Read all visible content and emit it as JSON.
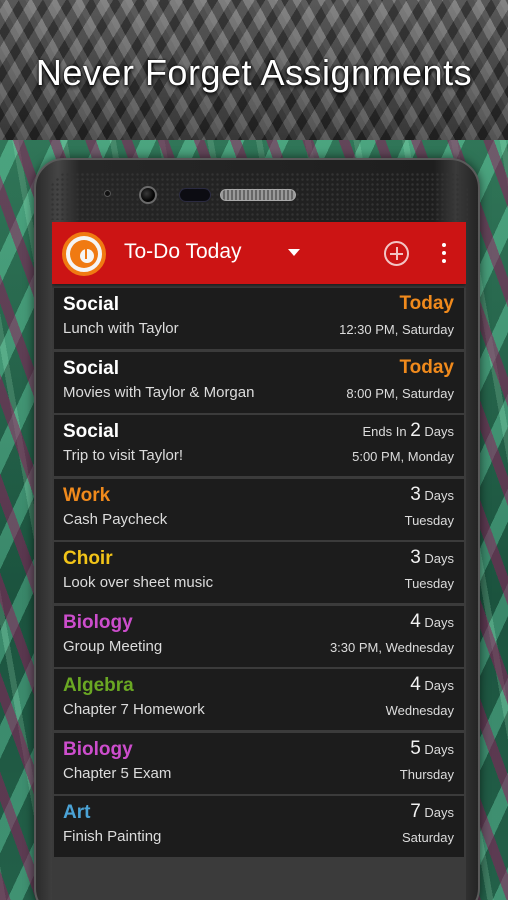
{
  "headline": "Never Forget Assignments",
  "app_bar": {
    "title": "To-Do Today",
    "logo_icon": "clock-logo-icon",
    "dropdown_icon": "triangle-down-icon",
    "add_icon": "plus-circle-icon",
    "more_icon": "more-vert-icon",
    "color": "#cc1414"
  },
  "colors": {
    "social": "#ffffff",
    "work": "#f08a1c",
    "choir": "#f2c418",
    "biology": "#cc4dcc",
    "algebra": "#6aa823",
    "art": "#4ba3d6",
    "today": "#f08a1c"
  },
  "assignments": [
    {
      "category": "Social",
      "color": "#ffffff",
      "description": "Lunch with Taylor",
      "due_prefix": "",
      "due_num": "",
      "due_suffix": "",
      "due_today": "Today",
      "when": "12:30 PM, Saturday"
    },
    {
      "category": "Social",
      "color": "#ffffff",
      "description": "Movies with Taylor & Morgan",
      "due_prefix": "",
      "due_num": "",
      "due_suffix": "",
      "due_today": "Today",
      "when": "8:00 PM, Saturday"
    },
    {
      "category": "Social",
      "color": "#ffffff",
      "description": "Trip to visit Taylor!",
      "due_prefix": "Ends In ",
      "due_num": "2",
      "due_suffix": " Days",
      "due_today": "",
      "when": "5:00 PM, Monday"
    },
    {
      "category": "Work",
      "color": "#f08a1c",
      "description": "Cash Paycheck",
      "due_prefix": "",
      "due_num": "3",
      "due_suffix": " Days",
      "due_today": "",
      "when": "Tuesday"
    },
    {
      "category": "Choir",
      "color": "#f2c418",
      "description": "Look over sheet music",
      "due_prefix": "",
      "due_num": "3",
      "due_suffix": " Days",
      "due_today": "",
      "when": "Tuesday"
    },
    {
      "category": "Biology",
      "color": "#cc4dcc",
      "description": "Group Meeting",
      "due_prefix": "",
      "due_num": "4",
      "due_suffix": " Days",
      "due_today": "",
      "when": "3:30 PM, Wednesday"
    },
    {
      "category": "Algebra",
      "color": "#6aa823",
      "description": "Chapter 7 Homework",
      "due_prefix": "",
      "due_num": "4",
      "due_suffix": " Days",
      "due_today": "",
      "when": "Wednesday"
    },
    {
      "category": "Biology",
      "color": "#cc4dcc",
      "description": "Chapter 5 Exam",
      "due_prefix": "",
      "due_num": "5",
      "due_suffix": " Days",
      "due_today": "",
      "when": "Thursday"
    },
    {
      "category": "Art",
      "color": "#4ba3d6",
      "description": "Finish Painting",
      "due_prefix": "",
      "due_num": "7",
      "due_suffix": " Days",
      "due_today": "",
      "when": "Saturday"
    }
  ]
}
